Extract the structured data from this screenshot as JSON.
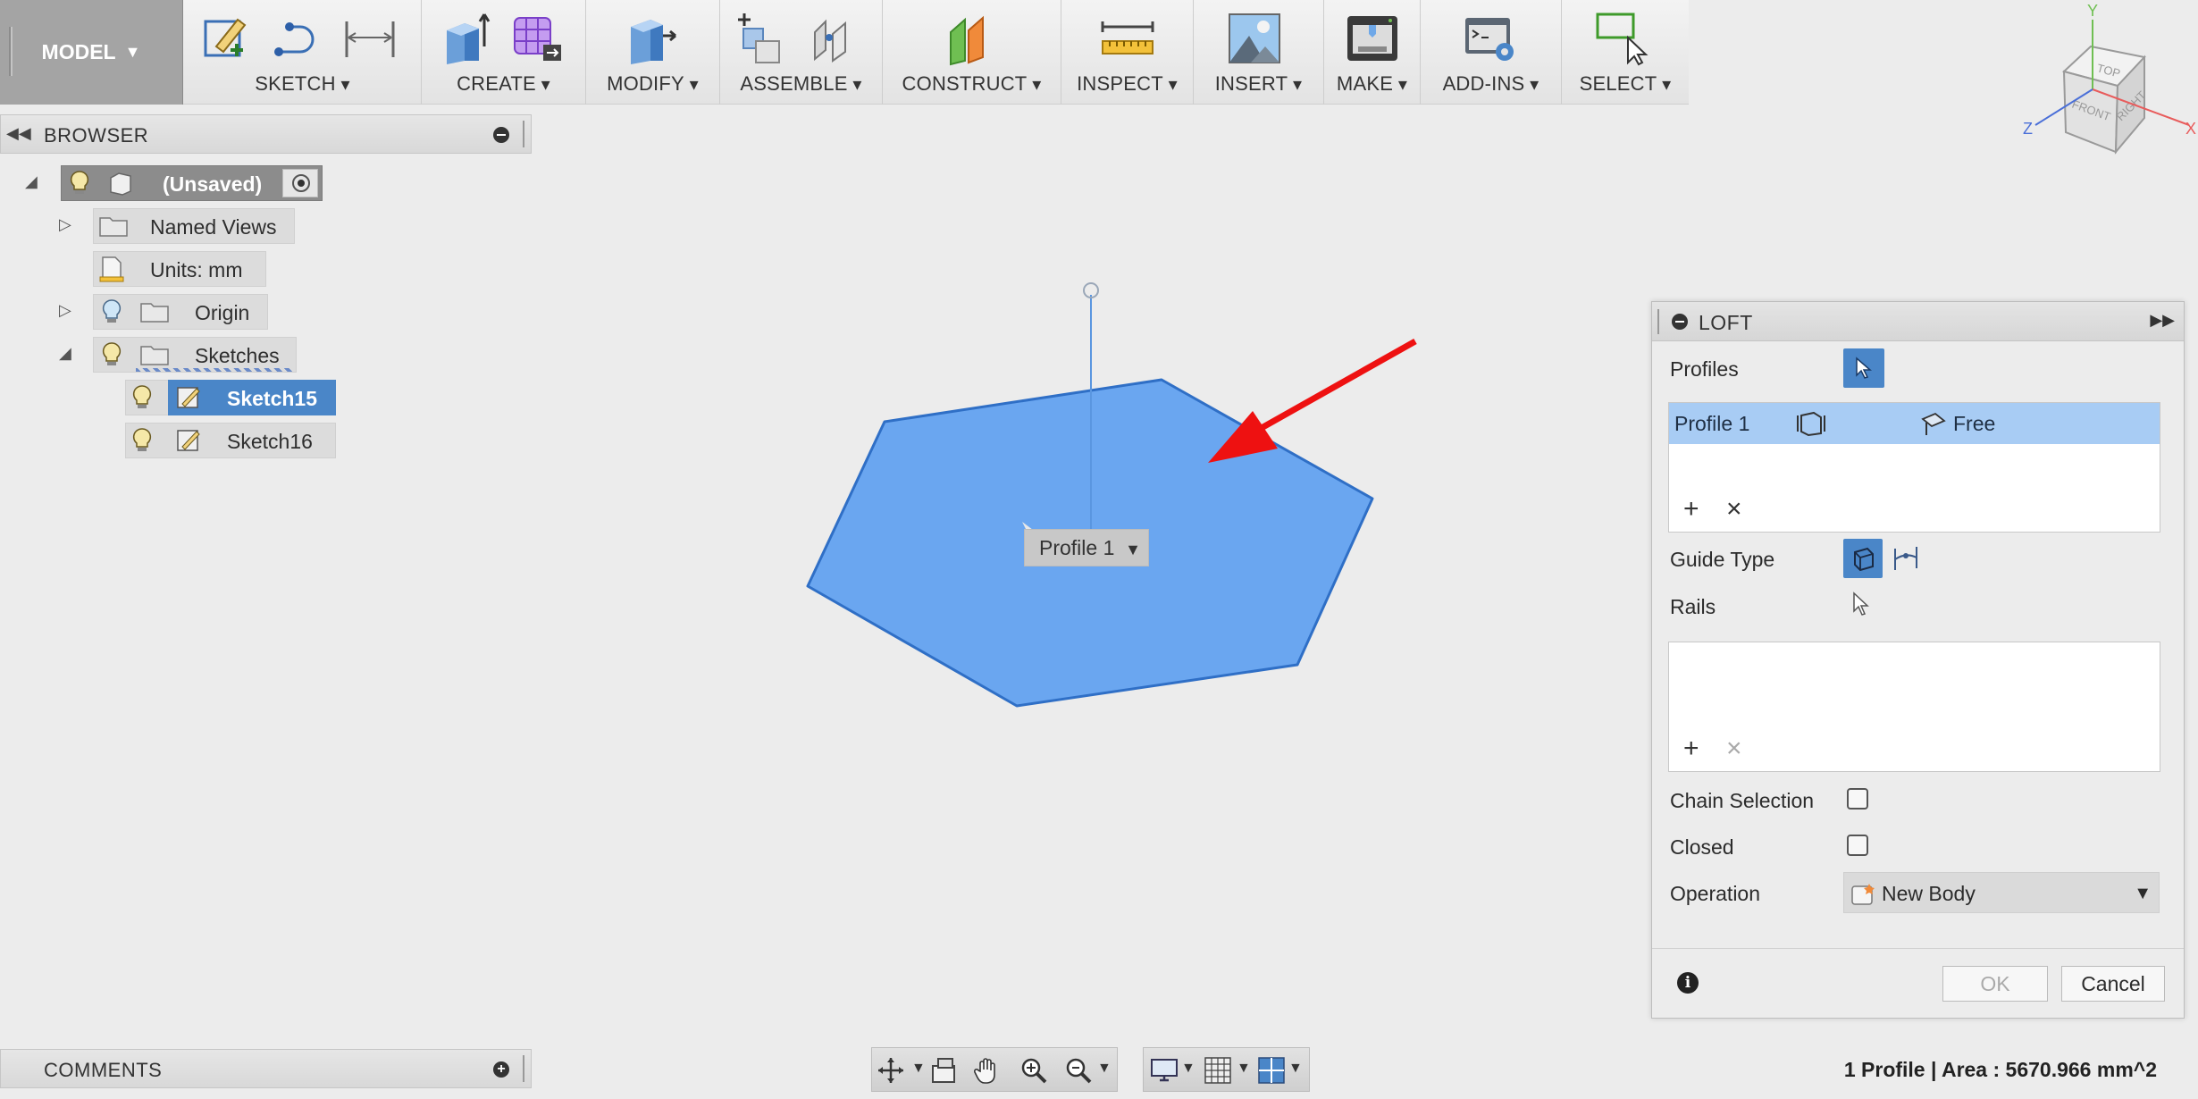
{
  "toolbar": {
    "workspace": "MODEL",
    "groups": [
      {
        "label": "SKETCH"
      },
      {
        "label": "CREATE"
      },
      {
        "label": "MODIFY"
      },
      {
        "label": "ASSEMBLE"
      },
      {
        "label": "CONSTRUCT"
      },
      {
        "label": "INSPECT"
      },
      {
        "label": "INSERT"
      },
      {
        "label": "MAKE"
      },
      {
        "label": "ADD-INS"
      },
      {
        "label": "SELECT"
      }
    ]
  },
  "viewcube": {
    "top": "TOP",
    "front": "FRONT",
    "right": "RIGHT",
    "axis_x": "X",
    "axis_y": "Y",
    "axis_z": "Z"
  },
  "browser": {
    "title": "BROWSER",
    "root": "(Unsaved)",
    "items": [
      {
        "label": "Named Views"
      },
      {
        "label": "Units: mm"
      },
      {
        "label": "Origin"
      },
      {
        "label": "Sketches"
      },
      {
        "label": "Sketch15"
      },
      {
        "label": "Sketch16"
      }
    ]
  },
  "canvas": {
    "profile_label": "Profile 1",
    "selection_color": "#6aa6f0",
    "arrow_color": "#ee1111"
  },
  "loft": {
    "title": "LOFT",
    "profiles_label": "Profiles",
    "profile_row": {
      "name": "Profile 1",
      "condition": "Free"
    },
    "guide_type_label": "Guide Type",
    "rails_label": "Rails",
    "chain_selection_label": "Chain Selection",
    "closed_label": "Closed",
    "operation_label": "Operation",
    "operation_value": "New Body",
    "ok": "OK",
    "cancel": "Cancel"
  },
  "comments": {
    "title": "COMMENTS"
  },
  "status": {
    "text": "1 Profile | Area : 5670.966 mm^2"
  }
}
